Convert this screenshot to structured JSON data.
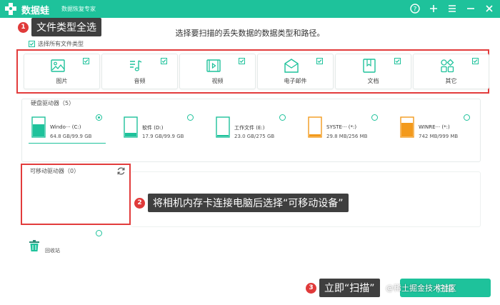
{
  "titlebar": {
    "app_name": "数据蛙",
    "app_subtitle": "数据恢复专家",
    "icons": [
      "help-icon",
      "plus-icon",
      "menu-icon",
      "minimize-icon",
      "close-icon"
    ],
    "bg_color": "#1ec29b"
  },
  "instruction": "选择要扫描的丢失数据的数据类型和路径。",
  "select_all": {
    "label": "选择所有文件类型",
    "checked": true
  },
  "file_types": [
    {
      "label": "图片",
      "icon": "image-icon",
      "checked": true
    },
    {
      "label": "音频",
      "icon": "music-icon",
      "checked": true
    },
    {
      "label": "视频",
      "icon": "video-icon",
      "checked": true
    },
    {
      "label": "电子邮件",
      "icon": "email-icon",
      "checked": true
    },
    {
      "label": "文档",
      "icon": "document-icon",
      "checked": true
    },
    {
      "label": "其它",
      "icon": "other-icon",
      "checked": true
    }
  ],
  "drives": {
    "title": "硬盘驱动器（5）",
    "items": [
      {
        "name": "Windo··· (C:)",
        "size": "64.8 GB/99.9 GB",
        "selected": true,
        "fill": 0.65,
        "color": "#1ec29b"
      },
      {
        "name": "软件 (D:)",
        "size": "17.9 GB/99.9 GB",
        "selected": false,
        "fill": 0.18,
        "color": "#1ec29b"
      },
      {
        "name": "工作文件 (E:)",
        "size": "23.0 GB/275 GB",
        "selected": false,
        "fill": 0.08,
        "color": "#1ec29b"
      },
      {
        "name": "SYSTE··· (*:)",
        "size": "29.8 MB/256 MB",
        "selected": false,
        "fill": 0.12,
        "color": "#f39a1c"
      },
      {
        "name": "WINRE··· (*:)",
        "size": "742 MB/999 MB",
        "selected": false,
        "fill": 0.74,
        "color": "#f39a1c"
      }
    ]
  },
  "removable": {
    "title": "可移动驱动器（0）",
    "refresh_icon": "refresh-icon"
  },
  "recycle_bin": {
    "label": "回收站",
    "icon": "trash-icon"
  },
  "scan_button": {
    "label": "扫描"
  },
  "annotations": [
    {
      "num": "1",
      "text": "文件类型全选"
    },
    {
      "num": "2",
      "text": "将相机内存卡连接电脑后选择“可移动设备”"
    },
    {
      "num": "3",
      "text": "立即“扫描”"
    }
  ],
  "watermark": "@稀土掘金技术社区"
}
